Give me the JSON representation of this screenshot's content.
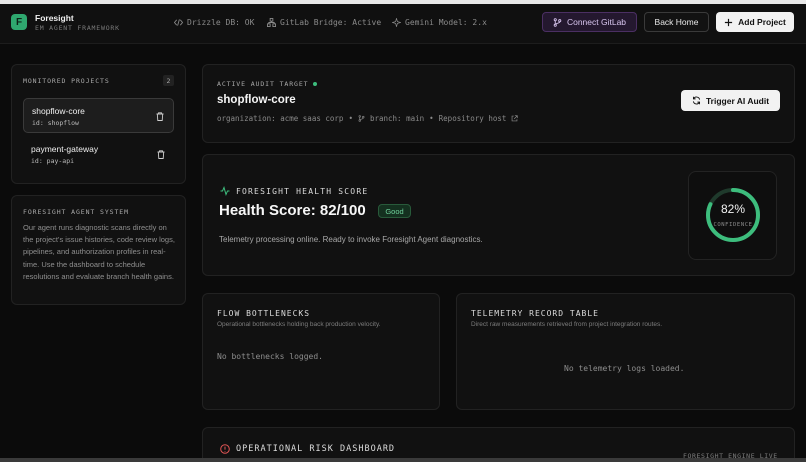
{
  "header": {
    "logo_letter": "F",
    "brand_name": "Foresight",
    "brand_sub": "EM AGENT FRAMEWORK",
    "status": [
      {
        "icon": "code-icon",
        "text": "Drizzle DB: OK"
      },
      {
        "icon": "network-icon",
        "text": "GitLab Bridge: Active"
      },
      {
        "icon": "sparkle-icon",
        "text": "Gemini Model: 2.x"
      }
    ],
    "connect_gitlab": "Connect GitLab",
    "back_home": "Back Home",
    "add_project": "Add Project"
  },
  "sidebar": {
    "projects_title": "MONITORED PROJECTS",
    "projects_count": "2",
    "projects": [
      {
        "name": "shopflow-core",
        "id": "id: shopflow",
        "active": true
      },
      {
        "name": "payment-gateway",
        "id": "id: pay-api",
        "active": false
      }
    ],
    "agent_title": "FORESIGHT AGENT SYSTEM",
    "agent_text": "Our agent runs diagnostic scans directly on the project's issue histories, code review logs, pipelines, and authorization profiles in real-time. Use the dashboard to schedule resolutions and evaluate branch health gains."
  },
  "audit": {
    "label": "ACTIVE AUDIT TARGET",
    "title": "shopflow-core",
    "organization": "organization: acme saas corp",
    "branch": "branch: main",
    "repo_host": "Repository host",
    "trigger": "Trigger AI Audit"
  },
  "health": {
    "label": "FORESIGHT HEALTH SCORE",
    "score_text": "Health Score: 82/100",
    "badge": "Good",
    "description": "Telemetry processing online. Ready to invoke Foresight Agent diagnostics.",
    "confidence_value": "82%",
    "confidence_fraction": 0.82,
    "confidence_label": "CONFIDENCE"
  },
  "flow": {
    "title": "FLOW BOTTLENECKS",
    "subtitle": "Operational bottlenecks holding back production velocity.",
    "empty": "No bottlenecks logged."
  },
  "telemetry": {
    "title": "TELEMETRY RECORD TABLE",
    "subtitle": "Direct raw measurements retrieved from project integration routes.",
    "empty": "No telemetry logs loaded."
  },
  "risk": {
    "title": "OPERATIONAL RISK DASHBOARD",
    "engine": "FORESIGHT ENGINE LIVE"
  },
  "colors": {
    "accent_green": "#3dbd7d",
    "gauge_track": "#1f3a2c",
    "gitlab_purple": "#4b2f63"
  }
}
